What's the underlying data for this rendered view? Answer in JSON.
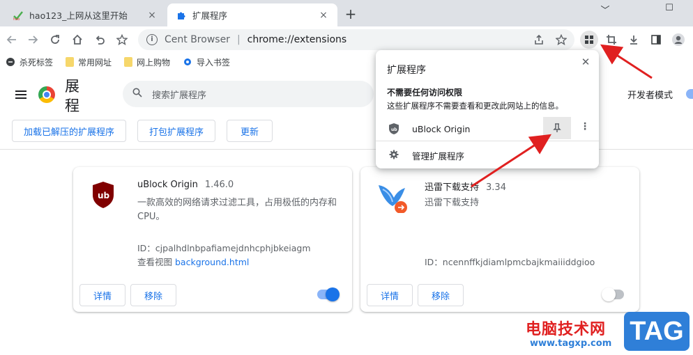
{
  "tabs": [
    {
      "title": "hao123_上网从这里开始",
      "close": "×",
      "active": false
    },
    {
      "title": "扩展程序",
      "close": "×",
      "active": true
    }
  ],
  "newtab": "+",
  "window": {
    "minimize": "﹀",
    "restore": "☐"
  },
  "omnibox": {
    "site": "Cent Browser",
    "separator": "|",
    "url": "chrome://extensions"
  },
  "bookmarks": [
    {
      "label": "杀死标签"
    },
    {
      "label": "常用网址"
    },
    {
      "label": "网上购物"
    },
    {
      "label": "导入书签"
    }
  ],
  "header": {
    "title": "展程",
    "search_placeholder": "搜索扩展程序",
    "dev_mode": "开发者模式"
  },
  "actions": {
    "load_unpacked": "加载已解压的扩展程序",
    "pack": "打包扩展程序",
    "update": "更新"
  },
  "cards": [
    {
      "name": "uBlock Origin",
      "version": "1.46.0",
      "description": "一款高效的网络请求过滤工具，占用极低的内存和CPU。",
      "id_text": "ID：cjpalhdlnbpafiamejdnhcphjbkeiagm",
      "views_label": "查看视图",
      "views_link": "background.html",
      "details": "详情",
      "remove": "移除",
      "enabled": true
    },
    {
      "name": "迅雷下载支持",
      "version": "3.34",
      "description": "迅雷下载支持",
      "id_text": "ID：ncennffkjdiamlpmcbajkmaiiiddgioo",
      "details": "详情",
      "remove": "移除",
      "enabled": false
    }
  ],
  "popup": {
    "title": "扩展程序",
    "close": "✕",
    "section_heading": "不需要任何访问权限",
    "section_desc": "这些扩展程序不需要查看和更改此网站上的信息。",
    "extension_name": "uBlock Origin",
    "more": "⋮",
    "manage_label": "管理扩展程序"
  },
  "watermark": {
    "text": "电脑技术网",
    "url": "www.tagxp.com",
    "tag": "TAG"
  },
  "colors": {
    "accent": "#1a73e8",
    "arrow": "#e02020",
    "watermark_blue": "#2f7fd8"
  }
}
